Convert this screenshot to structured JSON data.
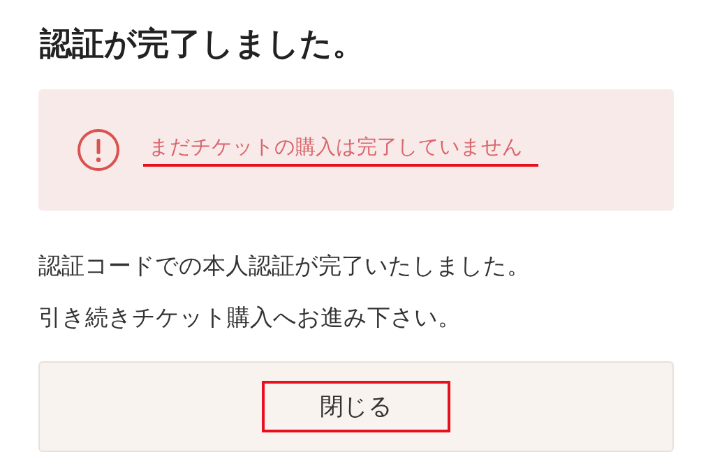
{
  "heading": "認証が完了しました。",
  "alert": {
    "message": "まだチケットの購入は完了していません",
    "highlighted": true
  },
  "body": [
    "認証コードでの本人認証が完了いたしました。",
    "引き続きチケット購入へお進み下さい。"
  ],
  "button": {
    "label": "閉じる",
    "highlighted": true
  }
}
